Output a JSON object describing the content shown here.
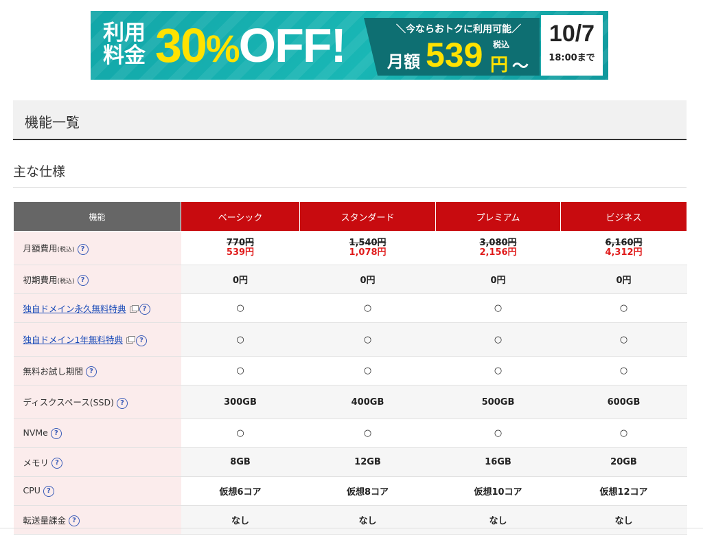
{
  "banner": {
    "price_label_1": "利用",
    "price_label_2": "料金",
    "discount_num": "30",
    "discount_pct": "%",
    "discount_off": "OFF!",
    "slogan": "＼今ならおトクに利用可能／",
    "month_label": "月額",
    "amount": "539",
    "tax_label": "税込",
    "yen": "円",
    "tilde": "〜",
    "date": "10/7",
    "until": "18:00まで",
    "colors": {
      "bg": "#12a6a8",
      "accent": "#ffe200",
      "dark": "#0e6f72"
    }
  },
  "section_title": "機能一覧",
  "subsection_title": "主な仕様",
  "table": {
    "header_feature": "機能",
    "plans": [
      "ベーシック",
      "スタンダード",
      "プレミアム",
      "ビジネス"
    ],
    "header_color": "#c80b0f",
    "rows": [
      {
        "label": "月額費用",
        "label_small": "(税込)",
        "help": "?",
        "old": [
          "770円",
          "1,540円",
          "3,080円",
          "6,160円"
        ],
        "values": [
          "539円",
          "1,078円",
          "2,156円",
          "4,312円"
        ]
      },
      {
        "label": "初期費用",
        "label_small": "(税込)",
        "help": "?",
        "values": [
          "0円",
          "0円",
          "0円",
          "0円"
        ]
      },
      {
        "label": "独自ドメイン永久無料特典",
        "help": "?",
        "values": [
          "○",
          "○",
          "○",
          "○"
        ]
      },
      {
        "label": "独自ドメイン1年無料特典",
        "help": "?",
        "values": [
          "○",
          "○",
          "○",
          "○"
        ]
      },
      {
        "label": "無料お試し期間",
        "help": "?",
        "values": [
          "○",
          "○",
          "○",
          "○"
        ]
      },
      {
        "label": "ディスクスペース(SSD)",
        "help": "?",
        "values": [
          "300GB",
          "400GB",
          "500GB",
          "600GB"
        ]
      },
      {
        "label": "NVMe",
        "help": "?",
        "values": [
          "○",
          "○",
          "○",
          "○"
        ]
      },
      {
        "label": "メモリ",
        "help": "?",
        "values": [
          "8GB",
          "12GB",
          "16GB",
          "20GB"
        ]
      },
      {
        "label": "CPU",
        "help": "?",
        "values": [
          "仮想6コア",
          "仮想8コア",
          "仮想10コア",
          "仮想12コア"
        ]
      },
      {
        "label": "転送量課金",
        "help": "?",
        "values": [
          "なし",
          "なし",
          "なし",
          "なし"
        ]
      }
    ]
  }
}
